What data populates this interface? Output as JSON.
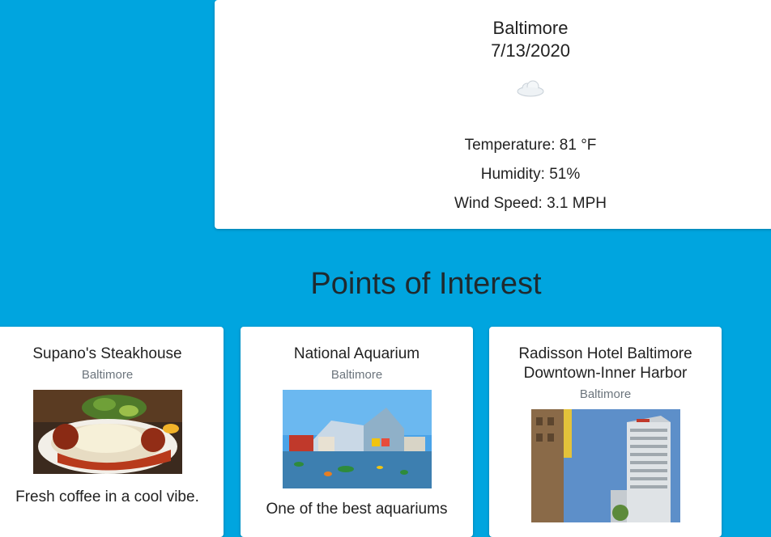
{
  "weather": {
    "city": "Baltimore",
    "date": "7/13/2020",
    "icon": "cloud-icon",
    "temperature": "Temperature: 81 °F",
    "humidity": "Humidity: 51%",
    "wind": "Wind Speed: 3.1 MPH"
  },
  "poi": {
    "title": "Points of Interest",
    "cards": [
      {
        "name": "Supano's Steakhouse",
        "city": "Baltimore",
        "image": "food-photo",
        "desc": "Fresh coffee in a cool vibe."
      },
      {
        "name": "National Aquarium",
        "city": "Baltimore",
        "image": "aquarium-photo",
        "desc": "One of the best aquariums"
      },
      {
        "name_line1": "Radisson Hotel Baltimore",
        "name_line2": "Downtown-Inner Harbor",
        "city": "Baltimore",
        "image": "hotel-photo"
      }
    ]
  },
  "colors": {
    "background": "#00a5df",
    "card": "#ffffff",
    "muted": "#6c757d"
  }
}
